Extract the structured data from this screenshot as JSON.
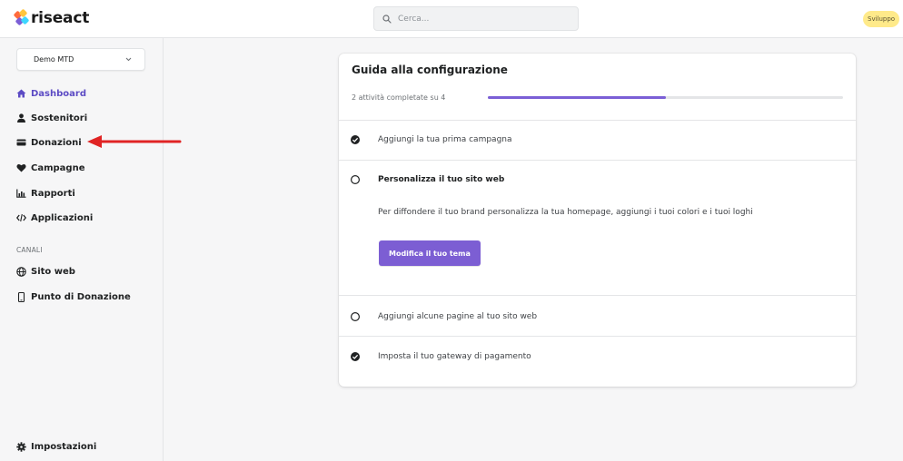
{
  "brand": {
    "name": "riseact",
    "logo_colors": [
      "#ff6b3d",
      "#ffc53d",
      "#3dd6ff",
      "#7b5fd6"
    ]
  },
  "search": {
    "placeholder": "Cerca...",
    "icon": "search-icon"
  },
  "environment_badge": "Sviluppo",
  "sidebar": {
    "store_selector": {
      "value": "Demo MTD",
      "icon": "chevron-down-icon"
    },
    "items": [
      {
        "label": "Dashboard",
        "icon": "home-icon",
        "active": true
      },
      {
        "label": "Sostenitori",
        "icon": "user-icon",
        "active": false
      },
      {
        "label": "Donazioni",
        "icon": "wallet-icon",
        "active": false
      },
      {
        "label": "Campagne",
        "icon": "heart-icon",
        "active": false
      },
      {
        "label": "Rapporti",
        "icon": "chart-icon",
        "active": false
      },
      {
        "label": "Applicazioni",
        "icon": "code-icon",
        "active": false
      }
    ],
    "section_label": "CANALI",
    "channels": [
      {
        "label": "Sito web",
        "icon": "globe-icon"
      },
      {
        "label": "Punto di Donazione",
        "icon": "mobile-icon"
      }
    ],
    "settings": {
      "label": "Impostazioni",
      "icon": "gear-icon"
    }
  },
  "guide": {
    "title": "Guida alla configurazione",
    "progress_label": "2 attività completate su 4",
    "progress_fraction": 0.5,
    "tasks": [
      {
        "label": "Aggiungi la tua prima campagna",
        "completed": true
      },
      {
        "label": "Personalizza il tuo sito web",
        "completed": false,
        "expanded": true,
        "description": "Per diffondere il tuo brand personalizza la tua homepage, aggiungi i tuoi colori e i tuoi loghi",
        "button_label": "Modifica il tuo tema"
      },
      {
        "label": "Aggiungi alcune pagine al tuo sito web",
        "completed": false
      },
      {
        "label": "Imposta il tuo gateway di pagamento",
        "completed": true
      }
    ]
  },
  "colors": {
    "accent": "#7c5ed3",
    "annotation_arrow": "#e02424",
    "badge": "#ffea8a"
  }
}
